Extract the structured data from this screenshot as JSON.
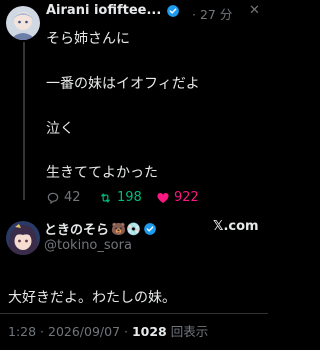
{
  "reply_tweet": {
    "author_name": "Airani iofiftee...",
    "time": "· 27 分",
    "more": "✕",
    "lines": [
      "そら姉さんに",
      "一番の妹はイオフィだよ",
      "泣く",
      "生きててよかった"
    ],
    "replies": "42",
    "retweets": "198",
    "likes": "922"
  },
  "main_tweet": {
    "author_name": "ときのそら",
    "badge_emojis": "🐻💿",
    "handle": "@tokino_sora",
    "platform": "𝕏.com",
    "text": "大好きだよ。わたしの妹。",
    "timestamp": "1:28 · 2026/09/07 · ",
    "views": "1028",
    "views_suffix": " 回表示"
  },
  "colors": {
    "background": "#000000",
    "text": "#e7e9ea",
    "muted": "#71767b",
    "verified": "#1d9bf0",
    "retweet": "#00ba7c",
    "like": "#f91880"
  }
}
